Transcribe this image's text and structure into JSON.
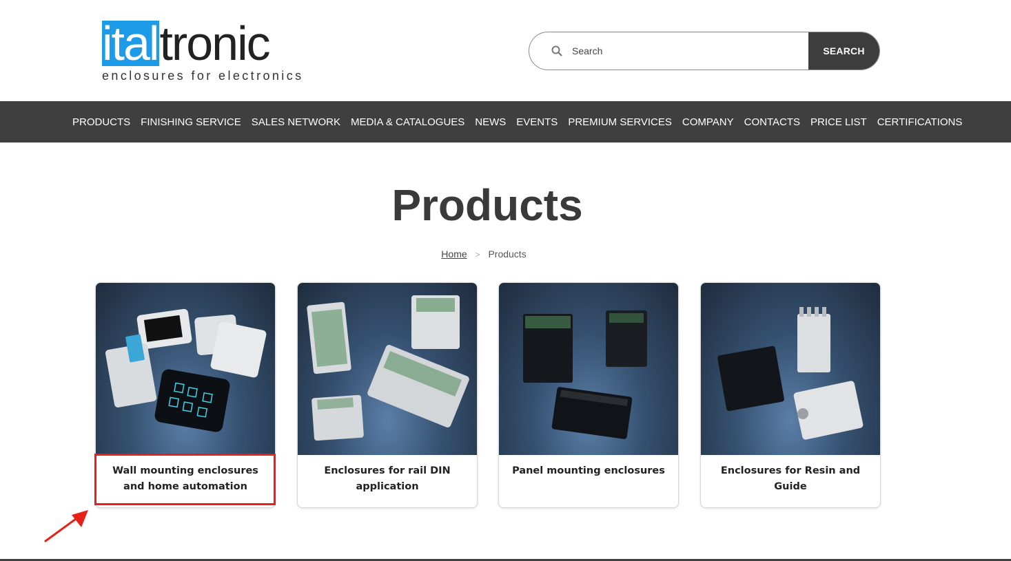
{
  "header": {
    "logo": {
      "part1": "ital",
      "part2": "tronic",
      "tagline": "enclosures for electronics"
    },
    "search": {
      "placeholder": "Search",
      "button_label": "SEARCH"
    }
  },
  "nav": {
    "items": [
      "PRODUCTS",
      "FINISHING SERVICE",
      "SALES NETWORK",
      "MEDIA & CATALOGUES",
      "NEWS",
      "EVENTS",
      "PREMIUM SERVICES",
      "COMPANY",
      "CONTACTS",
      "PRICE LIST",
      "CERTIFICATIONS"
    ]
  },
  "page": {
    "title": "Products",
    "breadcrumb": {
      "home": "Home",
      "separator": ">",
      "current": "Products"
    }
  },
  "cards": [
    {
      "title": "Wall mounting enclosures and home automation"
    },
    {
      "title": "Enclosures for rail DIN application"
    },
    {
      "title": "Panel mounting enclosures"
    },
    {
      "title": "Enclosures for Resin and Guide"
    }
  ],
  "colors": {
    "brand_blue": "#1e9be8",
    "nav_bg": "#3f3f3f",
    "highlight": "#e8201a"
  }
}
